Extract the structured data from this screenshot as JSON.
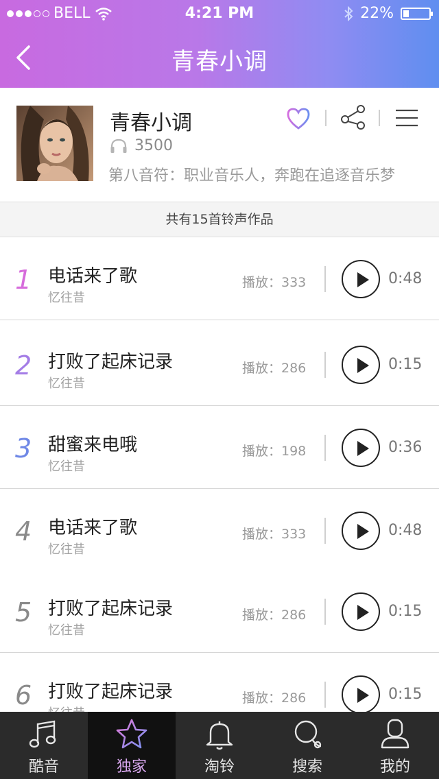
{
  "status_bar": {
    "carrier": "BELL",
    "time": "4:21 PM",
    "battery": "22%",
    "battery_fill": 0.22
  },
  "nav": {
    "title": "青春小调"
  },
  "profile": {
    "name": "青春小调",
    "play_count": "3500",
    "description": "第八音符：职业音乐人，奔跑在追逐音乐梦"
  },
  "count_text": "共有15首铃声作品",
  "songs": [
    {
      "num": "1",
      "title": "电话来了歌",
      "artist": "忆往昔",
      "plays": "播放：333",
      "duration": "0:48",
      "num_color": "#d66cdb"
    },
    {
      "num": "2",
      "title": "打败了起床记录",
      "artist": "忆往昔",
      "plays": "播放：286",
      "duration": "0:15",
      "num_color": "#a47de6"
    },
    {
      "num": "3",
      "title": "甜蜜来电哦",
      "artist": "忆往昔",
      "plays": "播放：198",
      "duration": "0:36",
      "num_color": "#6f88e6"
    },
    {
      "num": "4",
      "title": "电话来了歌",
      "artist": "忆往昔",
      "plays": "播放：333",
      "duration": "0:48",
      "num_color": "#8a8a8a"
    },
    {
      "num": "5",
      "title": "打败了起床记录",
      "artist": "忆往昔",
      "plays": "播放：286",
      "duration": "0:15",
      "num_color": "#8a8a8a"
    },
    {
      "num": "6",
      "title": "打败了起床记录",
      "artist": "忆往昔",
      "plays": "播放：286",
      "duration": "0:15",
      "num_color": "#8a8a8a"
    }
  ],
  "tabs": [
    {
      "label": "酷音",
      "icon": "music-note-icon"
    },
    {
      "label": "独家",
      "icon": "star-icon",
      "active": true
    },
    {
      "label": "淘铃",
      "icon": "bell-icon"
    },
    {
      "label": "搜索",
      "icon": "search-icon"
    },
    {
      "label": "我的",
      "icon": "user-icon"
    }
  ],
  "colors": {
    "accent": "#c86ae0",
    "header_end": "#5f8ef0",
    "tab_active": "#d9a8ef",
    "tabbar_bg": "#2b2b2b"
  }
}
